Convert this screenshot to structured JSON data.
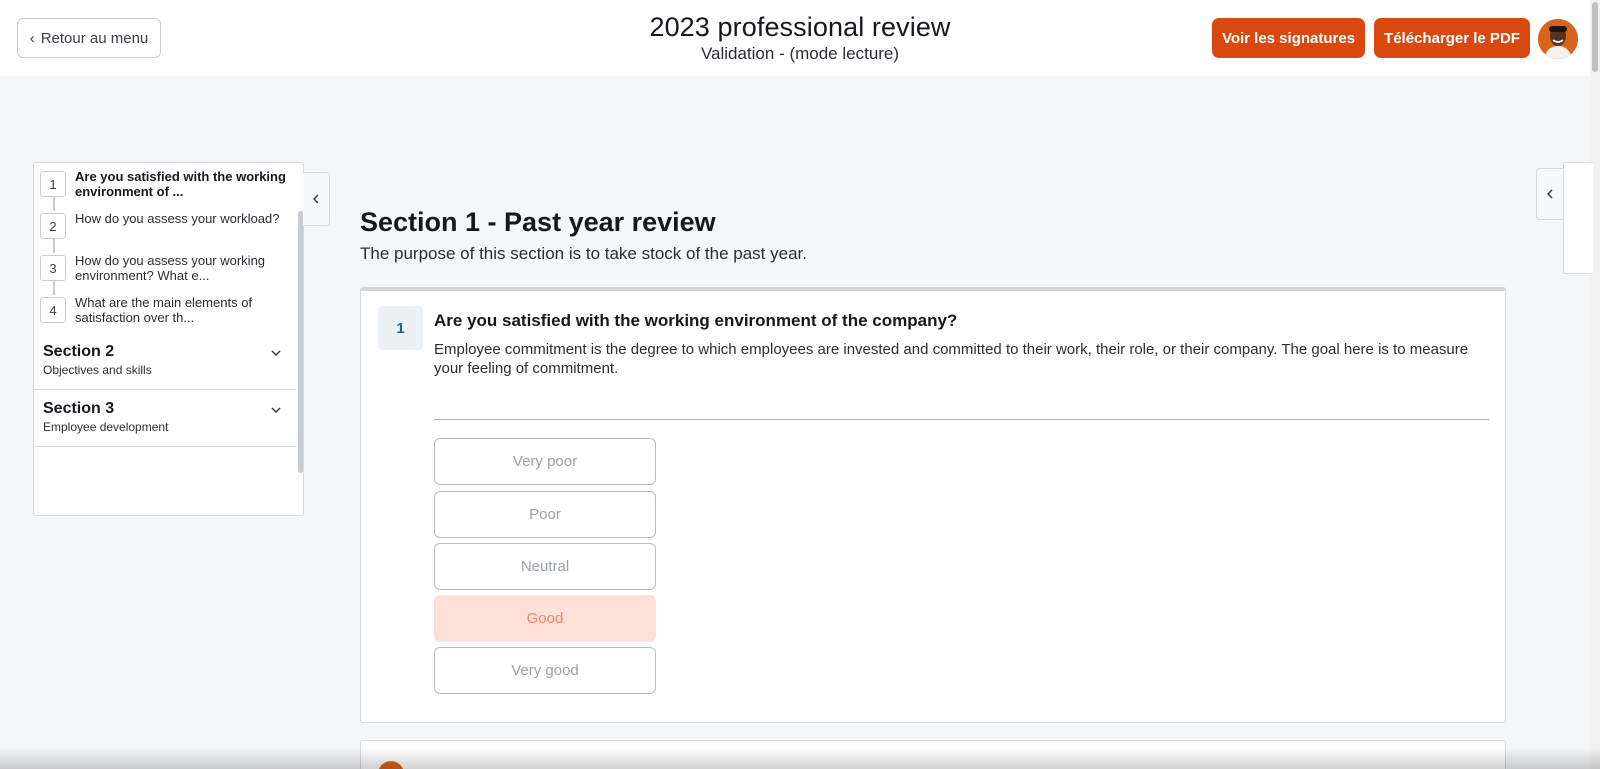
{
  "header": {
    "back_label": "Retour au menu",
    "title": "2023 professional review",
    "subtitle": "Validation - (mode lecture)",
    "signatures_label": "Voir les signatures",
    "pdf_label": "Télécharger le PDF",
    "avatar_icon": "user-avatar",
    "accent_color": "#d9480f"
  },
  "outline": {
    "questions": [
      {
        "num": "1",
        "label": "Are you satisfied with the working environment of ...",
        "active": true
      },
      {
        "num": "2",
        "label": "How do you assess your workload?"
      },
      {
        "num": "3",
        "label": "How do you assess your working environment? What e..."
      },
      {
        "num": "4",
        "label": "What are the main elements of satisfaction over th..."
      }
    ],
    "sections": [
      {
        "name": "Section 2",
        "desc": "Objectives and skills"
      },
      {
        "name": "Section 3",
        "desc": "Employee development"
      }
    ]
  },
  "main": {
    "section_title": "Section 1 - Past year review",
    "section_purpose": "The purpose of this section is to take stock of the past year.",
    "question": {
      "num": "1",
      "title": "Are you satisfied with the working environment of the company?",
      "description": "Employee commitment is the degree to which employees are invested and committed to their work, their role, or their company. The goal here is to measure your feeling of commitment.",
      "choices": [
        "Very poor",
        "Poor",
        "Neutral",
        "Good",
        "Very good"
      ],
      "selected": "Good"
    }
  }
}
